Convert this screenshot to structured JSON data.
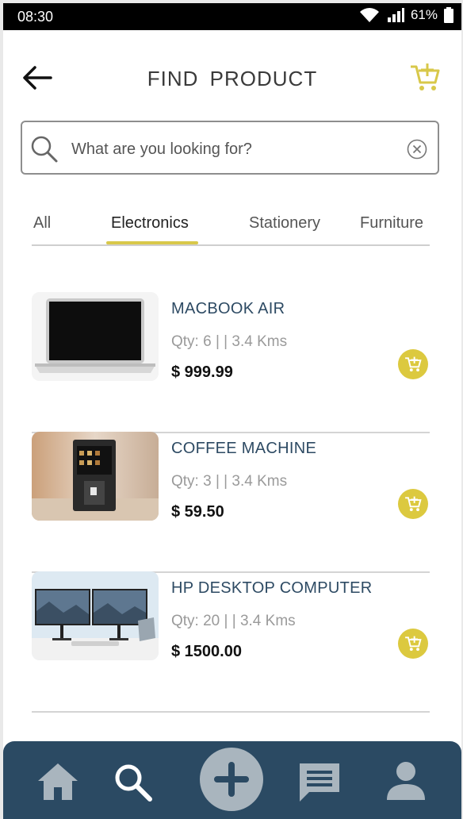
{
  "status_bar": {
    "time": "08:30",
    "battery": "61%"
  },
  "header": {
    "title": "FIND  PRODUCT"
  },
  "search": {
    "placeholder": "What are you looking for?",
    "value": ""
  },
  "tabs": [
    {
      "label": "All",
      "active": false
    },
    {
      "label": "Electronics",
      "active": true
    },
    {
      "label": "Stationery",
      "active": false
    },
    {
      "label": "Furniture",
      "active": false
    }
  ],
  "products": [
    {
      "name": "MACBOOK AIR",
      "qty": "Qty: 6 | | 3.4 Kms",
      "price": "$ 999.99"
    },
    {
      "name": "COFFEE MACHINE",
      "qty": "Qty: 3 | | 3.4 Kms",
      "price": "$ 59.50"
    },
    {
      "name": "HP DESKTOP COMPUTER",
      "qty": "Qty: 20 | | 3.4 Kms",
      "price": "$ 1500.00"
    }
  ],
  "bottom_nav": [
    "home-icon",
    "search-icon",
    "add-icon",
    "chat-icon",
    "profile-icon"
  ],
  "colors": {
    "accent": "#dcc93f",
    "nav_bg": "#2b4a63",
    "product_name": "#2d4a63"
  }
}
